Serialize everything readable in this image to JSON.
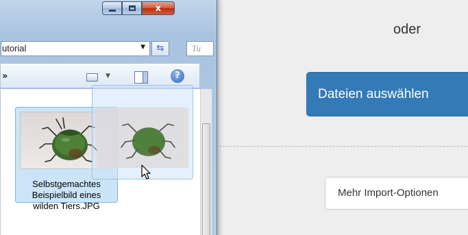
{
  "webpage": {
    "or_text": "oder",
    "select_files_button": "Dateien auswählen",
    "more_import_button": "Mehr Import-Optionen",
    "accent_color": "#337ab7"
  },
  "explorer": {
    "address_text": "utorial",
    "search_placeholder": "Tu",
    "toolbar_overflow": "»",
    "close_glyph": "x",
    "help_glyph": "?",
    "file": {
      "name": "Selbstgemachtes Beispielbild eines wilden Tiers.JPG",
      "name_lines": [
        "Selbstgemachtes",
        "Beispielbild eines",
        "wilden Tiers.JPG"
      ]
    }
  },
  "icons": {
    "minimize": "minimize-icon",
    "maximize": "maximize-icon",
    "close": "close-icon",
    "refresh": "refresh-icon",
    "views": "views-icon",
    "preview_pane": "preview-pane-icon",
    "help": "help-icon",
    "cursor": "mouse-cursor-icon"
  }
}
